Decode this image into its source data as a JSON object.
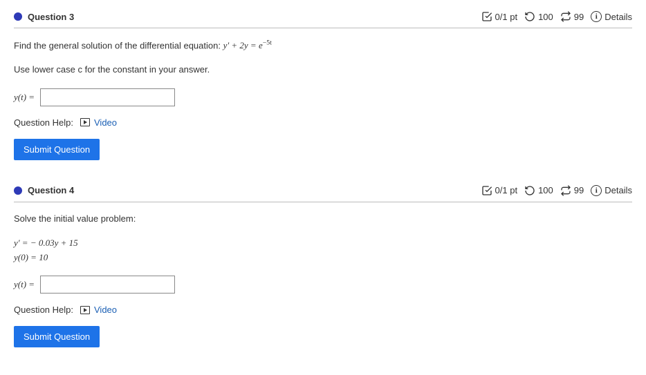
{
  "questions": [
    {
      "title": "Question 3",
      "points": "0/1 pt",
      "attempts_back": "100",
      "attempts_swap": "99",
      "details_label": "Details",
      "prompt_prefix": "Find the general solution of the differential equation: ",
      "equation_html": "y' + 2y = e",
      "equation_exp": "−5t",
      "prompt_note": "Use lower case c for the constant in your answer.",
      "answer_label_html": "y(t) = ",
      "help_label": "Question Help:",
      "video_label": "Video",
      "submit_label": "Submit Question"
    },
    {
      "title": "Question 4",
      "points": "0/1 pt",
      "attempts_back": "100",
      "attempts_swap": "99",
      "details_label": "Details",
      "prompt_prefix": "Solve the initial value problem:",
      "eq_line1": "y'  =  − 0.03y + 15",
      "eq_line2": "y(0)  =  10",
      "answer_label_html": "y(t) = ",
      "help_label": "Question Help:",
      "video_label": "Video",
      "submit_label": "Submit Question"
    }
  ]
}
